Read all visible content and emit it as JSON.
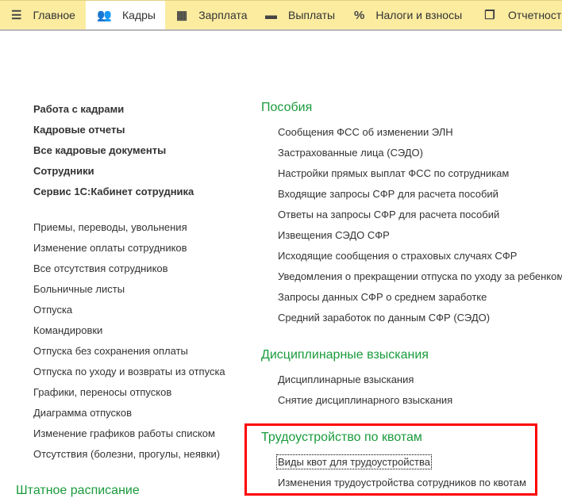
{
  "tabs": [
    {
      "label": "Главное",
      "icon": "menu-icon"
    },
    {
      "label": "Кадры",
      "icon": "people-icon",
      "active": true
    },
    {
      "label": "Зарплата",
      "icon": "calculator-icon"
    },
    {
      "label": "Выплаты",
      "icon": "wallet-icon"
    },
    {
      "label": "Налоги и взносы",
      "icon": "percent-icon"
    },
    {
      "label": "Отчетность",
      "icon": "documents-icon"
    }
  ],
  "left": {
    "bold_items": [
      "Работа с кадрами",
      "Кадровые отчеты",
      "Все кадровые документы",
      "Сотрудники",
      "Сервис 1С:Кабинет сотрудника"
    ],
    "items": [
      "Приемы, переводы, увольнения",
      "Изменение оплаты сотрудников",
      "Все отсутствия сотрудников",
      "Больничные листы",
      "Отпуска",
      "Командировки",
      "Отпуска без сохранения оплаты",
      "Отпуска по уходу и возвраты из отпуска",
      "Графики, переносы отпусков",
      "Диаграмма отпусков",
      "Изменение графиков работы списком",
      "Отсутствия (болезни, прогулы, неявки)"
    ],
    "section": "Штатное расписание"
  },
  "right": {
    "benefits": {
      "title": "Пособия",
      "items": [
        "Сообщения ФСС об изменении ЭЛН",
        "Застрахованные лица (СЭДО)",
        "Настройки прямых выплат ФСС по сотрудникам",
        "Входящие запросы СФР для расчета пособий",
        "Ответы на запросы СФР для расчета пособий",
        "Извещения СЭДО СФР",
        "Исходящие сообщения о страховых случаях СФР",
        "Уведомления о прекращении отпуска по уходу за ребенком",
        "Запросы данных СФР о среднем заработке",
        "Средний заработок по данным СФР (СЭДО)"
      ]
    },
    "discipline": {
      "title": "Дисциплинарные взыскания",
      "items": [
        "Дисциплинарные взыскания",
        "Снятие дисциплинарного взыскания"
      ]
    },
    "quotas": {
      "title": "Трудоустройство по квотам",
      "items": [
        "Виды квот для трудоустройства",
        "Изменения трудоустройства сотрудников по квотам"
      ]
    }
  }
}
